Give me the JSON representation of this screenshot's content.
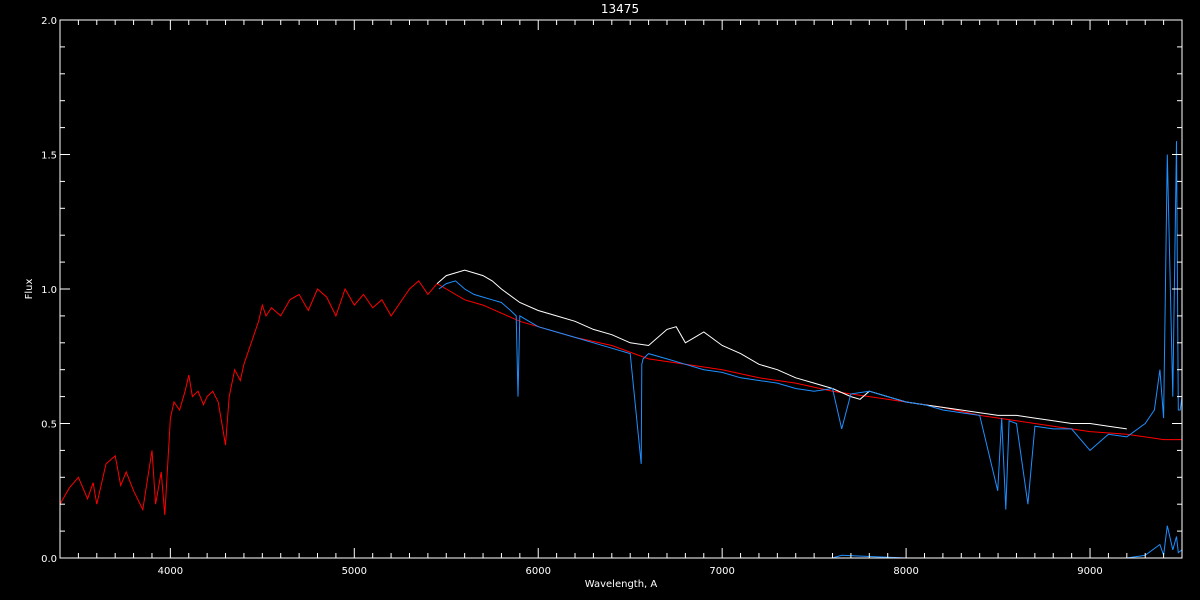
{
  "chart_data": {
    "type": "line",
    "title": "13475",
    "xlabel": "Wavelength, A",
    "ylabel": "Flux",
    "xlim": [
      3400,
      9500
    ],
    "ylim": [
      0,
      2.0
    ],
    "x_ticks": [
      4000,
      5000,
      6000,
      7000,
      8000,
      9000
    ],
    "y_ticks": [
      0.0,
      0.5,
      1.0,
      1.5,
      2.0
    ],
    "x_tick_labels": [
      "4000",
      "5000",
      "6000",
      "7000",
      "8000",
      "9000"
    ],
    "y_tick_labels": [
      "0.0",
      "0.5",
      "1.0",
      "1.5",
      "2.0"
    ],
    "grid": false,
    "background": "#000000",
    "axis_color": "#ffffff",
    "series": [
      {
        "color": "#ff0000",
        "x": [
          3400,
          3450,
          3500,
          3550,
          3580,
          3600,
          3650,
          3700,
          3730,
          3760,
          3800,
          3850,
          3900,
          3920,
          3950,
          3970,
          4000,
          4020,
          4050,
          4080,
          4100,
          4120,
          4150,
          4180,
          4200,
          4230,
          4260,
          4280,
          4300,
          4320,
          4350,
          4380,
          4400,
          4420,
          4450,
          4480,
          4500,
          4520,
          4550,
          4600,
          4650,
          4700,
          4750,
          4800,
          4850,
          4900,
          4950,
          5000,
          5050,
          5100,
          5150,
          5200,
          5250,
          5300,
          5350,
          5400,
          5450,
          5500,
          5600,
          5700,
          5800,
          5900,
          6000,
          6200,
          6400,
          6600,
          6800,
          7000,
          7200,
          7400,
          7600,
          7800,
          8000,
          8200,
          8400,
          8600,
          8800,
          9000,
          9200,
          9300,
          9400,
          9500
        ],
        "y": [
          0.2,
          0.26,
          0.3,
          0.22,
          0.28,
          0.2,
          0.35,
          0.38,
          0.27,
          0.32,
          0.25,
          0.18,
          0.4,
          0.2,
          0.32,
          0.16,
          0.52,
          0.58,
          0.55,
          0.62,
          0.68,
          0.6,
          0.62,
          0.57,
          0.6,
          0.62,
          0.58,
          0.5,
          0.42,
          0.6,
          0.7,
          0.66,
          0.72,
          0.76,
          0.82,
          0.88,
          0.94,
          0.9,
          0.93,
          0.9,
          0.96,
          0.98,
          0.92,
          1.0,
          0.97,
          0.9,
          1.0,
          0.94,
          0.98,
          0.93,
          0.96,
          0.9,
          0.95,
          1.0,
          1.03,
          0.98,
          1.02,
          1.0,
          0.96,
          0.94,
          0.91,
          0.88,
          0.86,
          0.82,
          0.79,
          0.74,
          0.72,
          0.7,
          0.67,
          0.65,
          0.62,
          0.6,
          0.58,
          0.56,
          0.53,
          0.51,
          0.49,
          0.47,
          0.46,
          0.45,
          0.44,
          0.44
        ]
      },
      {
        "color": "#ffffff",
        "x": [
          5450,
          5500,
          5550,
          5600,
          5650,
          5700,
          5750,
          5800,
          5900,
          6000,
          6100,
          6200,
          6300,
          6400,
          6500,
          6600,
          6700,
          6750,
          6800,
          6850,
          6900,
          7000,
          7100,
          7200,
          7300,
          7400,
          7500,
          7600,
          7700,
          7750,
          7800,
          7900,
          8000,
          8100,
          8200,
          8300,
          8400,
          8500,
          8600,
          8700,
          8800,
          8900,
          9000,
          9100,
          9200
        ],
        "y": [
          1.02,
          1.05,
          1.06,
          1.07,
          1.06,
          1.05,
          1.03,
          1.0,
          0.95,
          0.92,
          0.9,
          0.88,
          0.85,
          0.83,
          0.8,
          0.79,
          0.85,
          0.86,
          0.8,
          0.82,
          0.84,
          0.79,
          0.76,
          0.72,
          0.7,
          0.67,
          0.65,
          0.63,
          0.6,
          0.59,
          0.62,
          0.6,
          0.58,
          0.57,
          0.56,
          0.55,
          0.54,
          0.53,
          0.53,
          0.52,
          0.51,
          0.5,
          0.5,
          0.49,
          0.48
        ]
      },
      {
        "color": "#1e8fff",
        "x": [
          5460,
          5500,
          5550,
          5600,
          5650,
          5700,
          5750,
          5800,
          5850,
          5880,
          5890,
          5900,
          5950,
          6000,
          6050,
          6100,
          6200,
          6300,
          6400,
          6500,
          6560,
          6563,
          6570,
          6600,
          6700,
          6800,
          6900,
          7000,
          7100,
          7200,
          7300,
          7400,
          7500,
          7600,
          7650,
          7700,
          7800,
          7900,
          8000,
          8100,
          8200,
          8300,
          8400,
          8498,
          8520,
          8542,
          8560,
          8600,
          8662,
          8700,
          8800,
          8900,
          9000,
          9100,
          9200,
          9300,
          9350,
          9380,
          9400,
          9420,
          9450,
          9470,
          9480,
          9490,
          9500
        ],
        "y": [
          1.0,
          1.02,
          1.03,
          1.0,
          0.98,
          0.97,
          0.96,
          0.95,
          0.92,
          0.9,
          0.6,
          0.9,
          0.88,
          0.86,
          0.85,
          0.84,
          0.82,
          0.8,
          0.78,
          0.76,
          0.35,
          0.72,
          0.74,
          0.76,
          0.74,
          0.72,
          0.7,
          0.69,
          0.67,
          0.66,
          0.65,
          0.63,
          0.62,
          0.63,
          0.48,
          0.61,
          0.62,
          0.6,
          0.58,
          0.57,
          0.55,
          0.54,
          0.53,
          0.25,
          0.52,
          0.18,
          0.51,
          0.5,
          0.2,
          0.49,
          0.48,
          0.48,
          0.4,
          0.46,
          0.45,
          0.5,
          0.55,
          0.7,
          0.52,
          1.5,
          0.6,
          1.55,
          0.55,
          0.55,
          0.6
        ]
      },
      {
        "color": "#1e8fff",
        "x": [
          5460,
          6000,
          7000,
          7600,
          7650,
          8000,
          9000,
          9200,
          9300,
          9380,
          9400,
          9420,
          9450,
          9470,
          9480,
          9500
        ],
        "y": [
          0.0,
          0.0,
          0.0,
          0.0,
          0.01,
          0.0,
          0.0,
          0.0,
          0.01,
          0.05,
          0.01,
          0.12,
          0.03,
          0.08,
          0.02,
          0.03
        ]
      }
    ]
  }
}
